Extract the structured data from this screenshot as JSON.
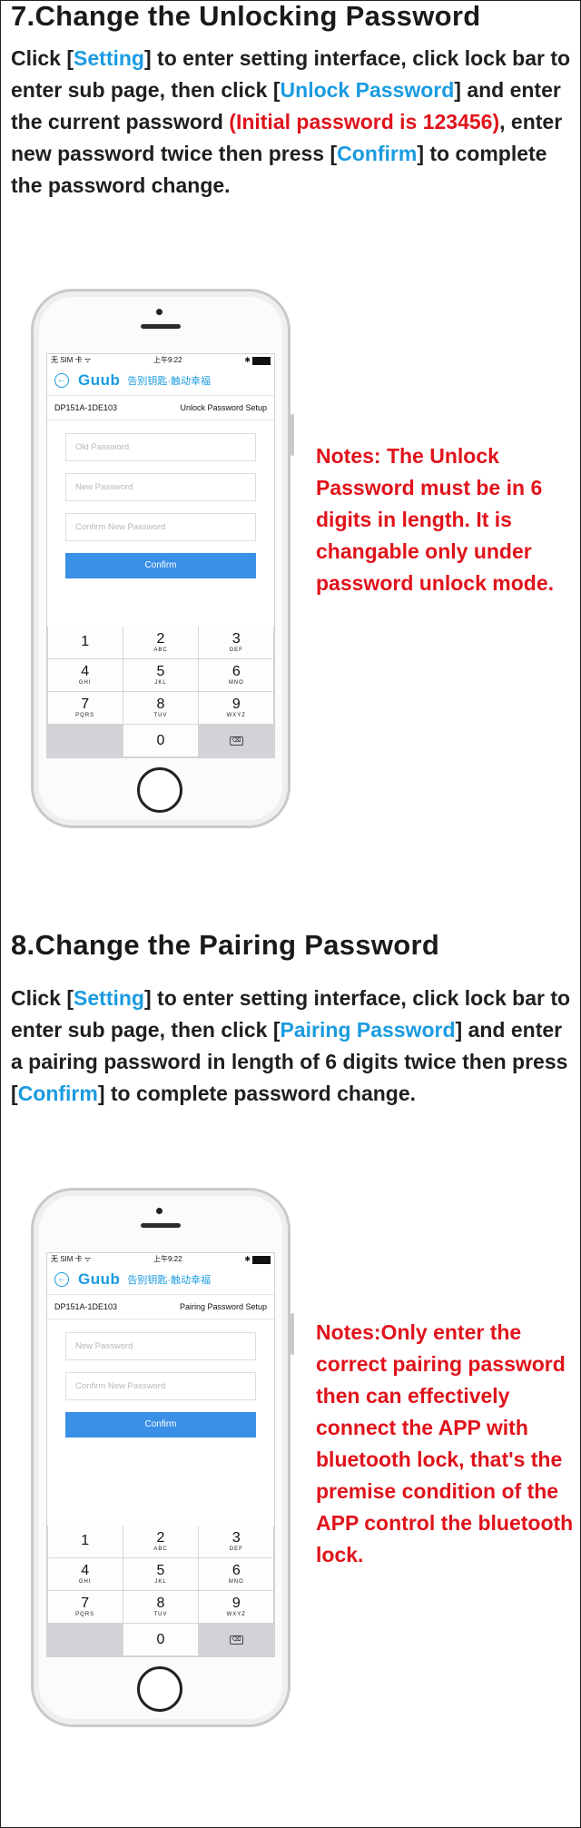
{
  "section7": {
    "heading": "7.Change the Unlocking Password",
    "para": {
      "p1": "Click [",
      "k1": "Setting",
      "p2": "] to enter setting interface, click lock bar to enter sub page, then click [",
      "k2": "Unlock Password",
      "p3": "] and enter the current password ",
      "r1": "(Initial password is 123456)",
      "p4": ", enter new password twice then press [",
      "k3": "Confirm",
      "p5": "] to complete the password change."
    },
    "note": "Notes: The Unlock Password must be in 6 digits in length. It is changable only under password unlock mode.",
    "phone": {
      "status_left": "无 SIM 卡 ᯤ",
      "status_time": "上午9:22",
      "status_right": "✱",
      "logo": "Guub",
      "slogan": "告别钥匙·触动幸福",
      "device": "DP151A-1DE103",
      "page_title": "Unlock Password Setup",
      "fields": [
        "Old Password",
        "New Password",
        "Confirm New Password"
      ],
      "confirm": "Confirm"
    }
  },
  "section8": {
    "heading": "8.Change the Pairing Password",
    "para": {
      "p1": "Click [",
      "k1": "Setting",
      "p2": "] to enter setting interface, click lock bar to enter sub page, then click [",
      "k2": "Pairing Password",
      "p3": "] and enter a pairing password in length of 6 digits twice then press [",
      "k3": "Confirm",
      "p4": "] to complete password change."
    },
    "note": "Notes:Only enter the correct pairing password then can effectively connect the APP with bluetooth lock, that's the premise condition of the APP control the bluetooth lock.",
    "phone": {
      "status_left": "无 SIM 卡 ᯤ",
      "status_time": "上午9:22",
      "status_right": "✱",
      "logo": "Guub",
      "slogan": "告别钥匙·触动幸福",
      "device": "DP151A-1DE103",
      "page_title": "Pairing Password Setup",
      "fields": [
        "New Password",
        "Confirm New Password"
      ],
      "confirm": "Confirm"
    }
  },
  "keypad": {
    "k1": "1",
    "k2": "2",
    "k2l": "ABC",
    "k3": "3",
    "k3l": "DEF",
    "k4": "4",
    "k4l": "GHI",
    "k5": "5",
    "k5l": "JKL",
    "k6": "6",
    "k6l": "MNO",
    "k7": "7",
    "k7l": "PQRS",
    "k8": "8",
    "k8l": "TUV",
    "k9": "9",
    "k9l": "WXYZ",
    "k0": "0",
    "del": "⌫"
  },
  "colors": {
    "keyword": "#1a9be0",
    "note": "#e0131b",
    "confirm_button": "#3a8fe6"
  }
}
